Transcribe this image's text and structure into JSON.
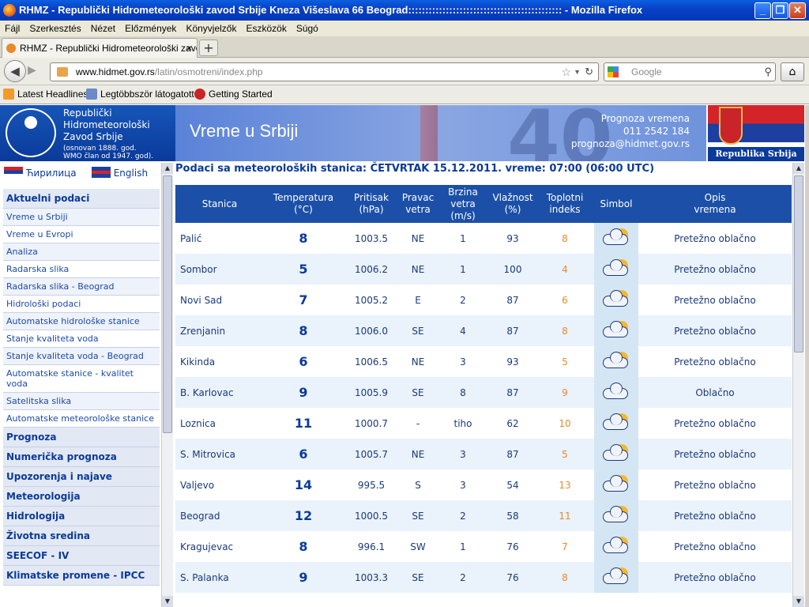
{
  "window": {
    "title": "RHMZ - Republički Hidrometeorološki zavod Srbije Kneza Višeslava 66 Beograd::::::::::::::::::::::::::::::::::::::::::::: - Mozilla Firefox",
    "minimize": "_",
    "maximize": "❐",
    "close": "✕"
  },
  "menu": [
    "Fájl",
    "Szerkesztés",
    "Nézet",
    "Előzmények",
    "Könyvjelzők",
    "Eszközök",
    "Súgó"
  ],
  "tab": {
    "label": "RHMZ - Republički Hidrometeorološki zavod ...",
    "close": "×",
    "new": "+"
  },
  "nav": {
    "url_host": "www.hidmet.gov.rs",
    "url_path": "/latin/osmotreni/index.php",
    "search_placeholder": "Google"
  },
  "bookmarks": [
    "Latest Headlines",
    "Legtöbbször látogatott",
    "Getting Started"
  ],
  "logo": {
    "line1": "Republički",
    "line2": "Hidrometeorološki",
    "line3": "Zavod Srbije",
    "small1": "(osnovan 1888. god.",
    "small2": "WMO član od 1947. god)."
  },
  "banner": {
    "title": "Vreme u Srbiji",
    "contact1": "Prognoza vremena",
    "contact2": "011 2542 184",
    "contact3": "prognoza@hidmet.gov.rs",
    "deco_number": "40"
  },
  "flag_caption": "Republika Srbija",
  "languages": {
    "cyrillic": "Ћирилица",
    "english": "English"
  },
  "sidebar": [
    {
      "label": "Aktuelni podaci",
      "type": "section"
    },
    {
      "label": "Vreme u Srbiji",
      "type": "item"
    },
    {
      "label": "Vreme u Evropi",
      "type": "item"
    },
    {
      "label": "Analiza",
      "type": "item"
    },
    {
      "label": "Radarska slika",
      "type": "item"
    },
    {
      "label": "Radarska slika - Beograd",
      "type": "item"
    },
    {
      "label": "Hidrološki podaci",
      "type": "item"
    },
    {
      "label": "Automatske hidrološke stanice",
      "type": "item"
    },
    {
      "label": "Stanje kvaliteta voda",
      "type": "item"
    },
    {
      "label": "Stanje kvaliteta voda - Beograd",
      "type": "item"
    },
    {
      "label": "Automatske stanice - kvalitet voda",
      "type": "item"
    },
    {
      "label": "Satelitska slika",
      "type": "item"
    },
    {
      "label": "Automatske meteorološke stanice",
      "type": "item"
    },
    {
      "label": "Prognoza",
      "type": "section"
    },
    {
      "label": "Numerička prognoza",
      "type": "section"
    },
    {
      "label": "Upozorenja i najave",
      "type": "section"
    },
    {
      "label": "Meteorologija",
      "type": "section"
    },
    {
      "label": "Hidrologija",
      "type": "section"
    },
    {
      "label": "Životna sredina",
      "type": "section"
    },
    {
      "label": "SEECOF - IV",
      "type": "section"
    },
    {
      "label": "Klimatske promene - IPCC",
      "type": "section"
    }
  ],
  "observations": {
    "header": "Podaci sa meteoroloških stanica:  ČETVRTAK 15.12.2011.  vreme: 07:00 (06:00 UTC)",
    "columns": [
      {
        "line1": "Stanica",
        "line2": ""
      },
      {
        "line1": "Temperatura",
        "line2": "(°C)"
      },
      {
        "line1": "Pritisak",
        "line2": "(hPa)"
      },
      {
        "line1": "Pravac",
        "line2": "vetra"
      },
      {
        "line1": "Brzina",
        "line2": "vetra",
        "line3": "(m/s)"
      },
      {
        "line1": "Vlažnost",
        "line2": "(%)"
      },
      {
        "line1": "Toplotni",
        "line2": "indeks"
      },
      {
        "line1": "Simbol",
        "line2": ""
      },
      {
        "line1": "Opis",
        "line2": "vremena"
      }
    ],
    "rows": [
      {
        "station": "Palić",
        "temp": "8",
        "pressure": "1003.5",
        "dir": "NE",
        "speed": "1",
        "humidity": "93",
        "heat": "8",
        "icon": "partly-cloudy-icon",
        "desc": "Pretežno oblačno"
      },
      {
        "station": "Sombor",
        "temp": "5",
        "pressure": "1006.2",
        "dir": "NE",
        "speed": "1",
        "humidity": "100",
        "heat": "4",
        "icon": "partly-cloudy-icon",
        "desc": "Pretežno oblačno"
      },
      {
        "station": "Novi Sad",
        "temp": "7",
        "pressure": "1005.2",
        "dir": "E",
        "speed": "2",
        "humidity": "87",
        "heat": "6",
        "icon": "partly-cloudy-icon",
        "desc": "Pretežno oblačno"
      },
      {
        "station": "Zrenjanin",
        "temp": "8",
        "pressure": "1006.0",
        "dir": "SE",
        "speed": "4",
        "humidity": "87",
        "heat": "8",
        "icon": "partly-cloudy-icon",
        "desc": "Pretežno oblačno"
      },
      {
        "station": "Kikinda",
        "temp": "6",
        "pressure": "1006.5",
        "dir": "NE",
        "speed": "3",
        "humidity": "93",
        "heat": "5",
        "icon": "partly-cloudy-icon",
        "desc": "Pretežno oblačno"
      },
      {
        "station": "B. Karlovac",
        "temp": "9",
        "pressure": "1005.9",
        "dir": "SE",
        "speed": "8",
        "humidity": "87",
        "heat": "9",
        "icon": "cloudy-icon",
        "desc": "Oblačno"
      },
      {
        "station": "Loznica",
        "temp": "11",
        "pressure": "1000.7",
        "dir": "-",
        "speed": "tiho",
        "humidity": "62",
        "heat": "10",
        "icon": "partly-cloudy-icon",
        "desc": "Pretežno oblačno"
      },
      {
        "station": "S. Mitrovica",
        "temp": "6",
        "pressure": "1005.7",
        "dir": "NE",
        "speed": "3",
        "humidity": "87",
        "heat": "5",
        "icon": "partly-cloudy-icon",
        "desc": "Pretežno oblačno"
      },
      {
        "station": "Valjevo",
        "temp": "14",
        "pressure": "995.5",
        "dir": "S",
        "speed": "3",
        "humidity": "54",
        "heat": "13",
        "icon": "partly-cloudy-icon",
        "desc": "Pretežno oblačno"
      },
      {
        "station": "Beograd",
        "temp": "12",
        "pressure": "1000.5",
        "dir": "SE",
        "speed": "2",
        "humidity": "58",
        "heat": "11",
        "icon": "partly-cloudy-icon",
        "desc": "Pretežno oblačno"
      },
      {
        "station": "Kragujevac",
        "temp": "8",
        "pressure": "996.1",
        "dir": "SW",
        "speed": "1",
        "humidity": "76",
        "heat": "7",
        "icon": "partly-cloudy-icon",
        "desc": "Pretežno oblačno"
      },
      {
        "station": "S. Palanka",
        "temp": "9",
        "pressure": "1003.3",
        "dir": "SE",
        "speed": "2",
        "humidity": "76",
        "heat": "8",
        "icon": "partly-cloudy-icon",
        "desc": "Pretežno oblačno"
      }
    ]
  },
  "colors": {
    "header_blue": "#1c50a8",
    "heat_orange": "#e88a2a",
    "row_alt": "#eaf2fb"
  }
}
